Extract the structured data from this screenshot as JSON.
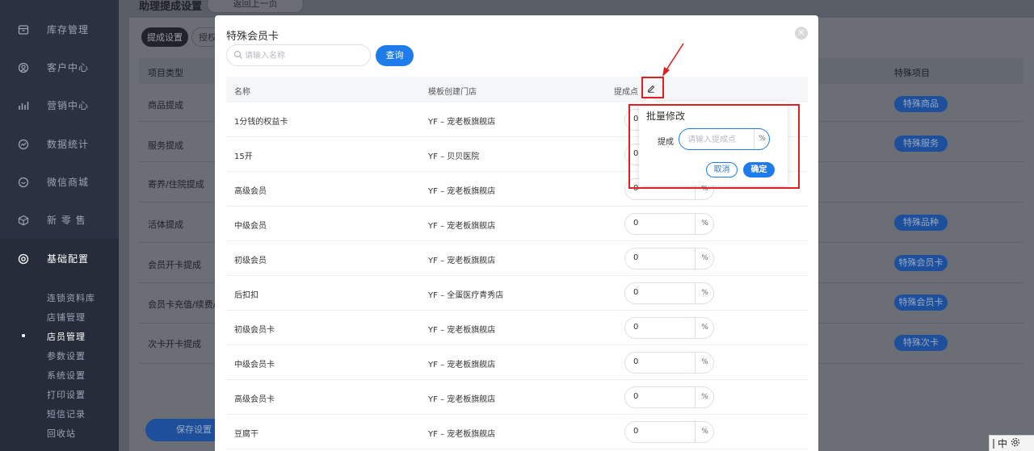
{
  "sidebar": {
    "items": [
      {
        "label": "库存管理",
        "icon": "inventory-icon"
      },
      {
        "label": "客户中心",
        "icon": "customer-icon"
      },
      {
        "label": "营销中心",
        "icon": "marketing-icon"
      },
      {
        "label": "数据统计",
        "icon": "statistics-icon"
      },
      {
        "label": "微信商城",
        "icon": "wechat-mall-icon"
      },
      {
        "label": "新 零 售",
        "icon": "retail-icon"
      },
      {
        "label": "基础配置",
        "icon": "config-icon"
      }
    ],
    "sub_items": [
      "连锁资料库",
      "店铺管理",
      "店员管理",
      "参数设置",
      "系统设置",
      "打印设置",
      "短信记录",
      "回收站"
    ]
  },
  "background_page": {
    "title": "助理提成设置",
    "back_label": "返回上一页",
    "tab_active": "提成设置",
    "tab_other": "授权",
    "col_type": "项目类型",
    "col_special": "特殊项目",
    "rows": [
      "商品提成",
      "服务提成",
      "寄养/住院提成",
      "活体提成",
      "会员开卡提成",
      "会员卡充值/续费/换",
      "次卡开卡提成"
    ],
    "special_buttons": [
      "特殊商品",
      "特殊服务",
      "特殊品种",
      "特殊会员卡",
      "特殊会员卡",
      "特殊次卡"
    ],
    "save_label": "保存设置"
  },
  "modal": {
    "title": "特殊会员卡",
    "search_placeholder": "请输入名称",
    "query_label": "查询",
    "columns": {
      "name": "名称",
      "store": "模板创建门店",
      "rate": "提成点"
    },
    "rows": [
      {
        "name": "1分钱的权益卡",
        "store": "YF – 宠老板旗舰店",
        "rate": "0"
      },
      {
        "name": "15开",
        "store": "YF – 贝贝医院",
        "rate": "0"
      },
      {
        "name": "高级会员",
        "store": "YF – 宠老板旗舰店",
        "rate": "0"
      },
      {
        "name": "中级会员",
        "store": "YF – 宠老板旗舰店",
        "rate": "0"
      },
      {
        "name": "初级会员",
        "store": "YF – 宠老板旗舰店",
        "rate": "0"
      },
      {
        "name": "后扣扣",
        "store": "YF – 全蛋医疗青秀店",
        "rate": "0"
      },
      {
        "name": "初级会员卡",
        "store": "YF – 宠老板旗舰店",
        "rate": "0"
      },
      {
        "name": "中级会员卡",
        "store": "YF – 宠老板旗舰店",
        "rate": "0"
      },
      {
        "name": "高级会员卡",
        "store": "YF – 宠老板旗舰店",
        "rate": "0"
      },
      {
        "name": "豆腐干",
        "store": "YF – 宠老板旗舰店",
        "rate": "0"
      }
    ],
    "unit": "%"
  },
  "popover": {
    "title": "批量修改",
    "label": "提成",
    "placeholder": "请输入提成点",
    "unit": "%",
    "cancel_label": "取消",
    "ok_label": "确定"
  },
  "ime": {
    "label": "中"
  },
  "colors": {
    "primary": "#1e7bea",
    "sidebar": "#2b3140",
    "annotation": "#e02020"
  }
}
